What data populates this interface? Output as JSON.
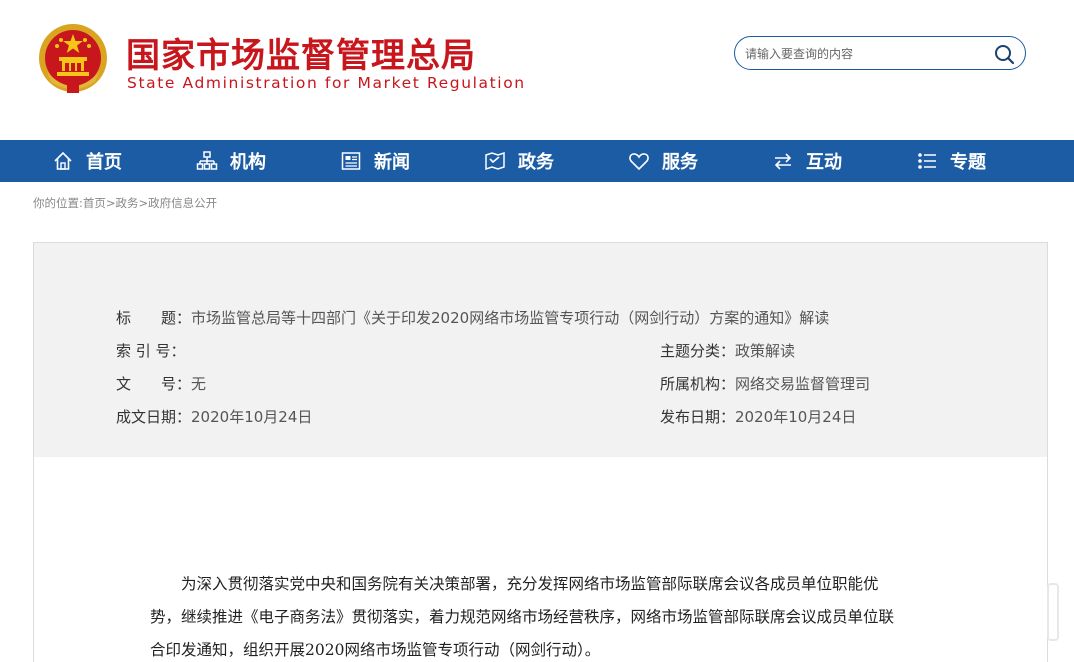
{
  "header": {
    "title_cn": "国家市场监督管理总局",
    "title_en": "State Administration for Market Regulation",
    "emblem_icon": "national-emblem-icon"
  },
  "search": {
    "placeholder": "请输入要查询的内容",
    "icon": "search-icon"
  },
  "nav": {
    "items": [
      {
        "label": "首页",
        "icon": "home-icon"
      },
      {
        "label": "机构",
        "icon": "org-chart-icon"
      },
      {
        "label": "新闻",
        "icon": "news-icon"
      },
      {
        "label": "政务",
        "icon": "government-affairs-icon"
      },
      {
        "label": "服务",
        "icon": "heart-icon"
      },
      {
        "label": "互动",
        "icon": "swap-arrows-icon"
      },
      {
        "label": "专题",
        "icon": "topics-list-icon"
      }
    ]
  },
  "breadcrumb": {
    "prefix": "你的位置:",
    "items": [
      "首页",
      "政务",
      "政府信息公开"
    ],
    "separator": ">"
  },
  "info": {
    "title_label": "标　　题：",
    "title_value": "市场监管总局等十四部门《关于印发2020网络市场监管专项行动（网剑行动）方案的通知》解读",
    "index_label": "索 引 号：",
    "index_value": "",
    "topic_label": "主题分类：",
    "topic_value": "政策解读",
    "doc_label": "文　　号：",
    "doc_value": "无",
    "agency_label": "所属机构：",
    "agency_value": "网络交易监督管理司",
    "created_label": "成文日期：",
    "created_value": "2020年10月24日",
    "published_label": "发布日期：",
    "published_value": "2020年10月24日"
  },
  "content": {
    "lines": [
      "　　为深入贯彻落实党中央和国务院有关决策部署，充分发挥网络市场监管部际联席会议各成员单位职能优",
      "势，继续推进《电子商务法》贯彻落实，着力规范网络市场经营秩序，网络市场监管部际联席会议成员单位联",
      "合印发通知，组织开展2020网络市场监管专项行动（网剑行动）。"
    ]
  },
  "colors": {
    "brand_red": "#c8161d",
    "nav_blue": "#1c5ca4",
    "panel_gray": "#f2f2f2"
  }
}
